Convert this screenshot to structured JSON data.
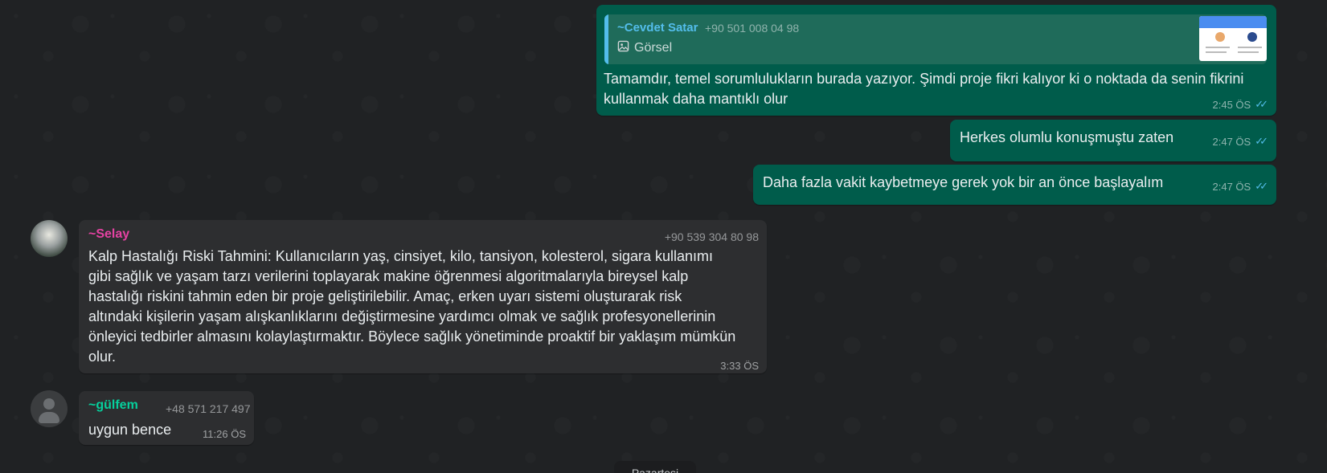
{
  "messages": {
    "m1": {
      "quote_name": "~Cevdet Satar",
      "quote_phone": "+90 501 008 04 98",
      "quote_type": "Görsel",
      "text": "Tamamdır, temel sorumlulukların burada yazıyor. Şimdi proje fikri kalıyor ki o noktada da senin fikrini kullanmak daha mantıklı olur",
      "time": "2:45 ÖS"
    },
    "m2": {
      "text": "Herkes olumlu konuşmuştu zaten",
      "time": "2:47 ÖS"
    },
    "m3": {
      "text": "Daha fazla vakit kaybetmeye gerek yok bir an önce başlayalım",
      "time": "2:47 ÖS"
    },
    "m4": {
      "sender": "~Selay",
      "phone": "+90 539 304 80 98",
      "text": "Kalp Hastalığı Riski Tahmini: Kullanıcıların yaş, cinsiyet, kilo, tansiyon, kolesterol, sigara kullanımı gibi sağlık ve yaşam tarzı verilerini toplayarak makine öğrenmesi algoritmalarıyla bireysel kalp hastalığı riskini tahmin eden bir proje geliştirilebilir. Amaç, erken uyarı sistemi oluşturarak risk altındaki kişilerin yaşam alışkanlıklarını değiştirmesine yardımcı olmak ve sağlık profesyonellerinin önleyici tedbirler almasını kolaylaştırmaktır. Böylece sağlık yönetiminde proaktif bir yaklaşım mümkün olur.",
      "time": "3:33 ÖS"
    },
    "m5": {
      "sender": "~gülfem",
      "phone": "+48 571 217 497",
      "text": "uygun bence",
      "time": "11:26 ÖS"
    }
  },
  "date_divider": "Pazartesi",
  "colors": {
    "outgoing_bubble": "#005c4b",
    "incoming_bubble": "#2d2e30",
    "selay_name": "#e542a3",
    "gulfem_name": "#06cf9c",
    "read_ticks": "#53bdeb"
  },
  "icons": {
    "image_icon": "image-icon",
    "read_ticks": "double-check-icon"
  }
}
